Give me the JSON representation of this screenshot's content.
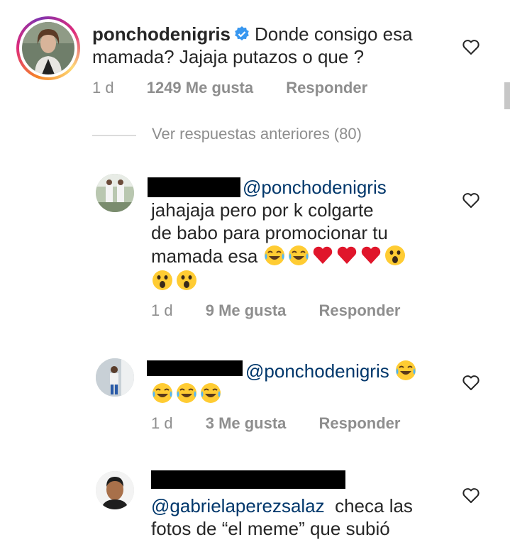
{
  "comments": [
    {
      "username": "ponchodenigris",
      "verified": true,
      "text": "Donde consigo esa mamada? Jajaja putazos o que ?",
      "time": "1 d",
      "likes": "1249 Me gusta",
      "reply": "Responder"
    },
    {
      "mention": "@ponchodenigris",
      "text_line1": "jahajaja pero por k colgarte",
      "text_line2": "de babo para promocionar tu",
      "text_line3": "mamada esa",
      "emoji_line3": [
        "joy-emoji",
        "joy-emoji",
        "heart-emoji",
        "heart-emoji",
        "heart-emoji",
        "astonished-emoji"
      ],
      "emoji_line4": [
        "astonished-emoji",
        "astonished-emoji"
      ],
      "time": "1 d",
      "likes": "9 Me gusta",
      "reply": "Responder"
    },
    {
      "mention": "@ponchodenigris",
      "emoji_line1": [
        "joy-emoji"
      ],
      "emoji_line2": [
        "joy-emoji",
        "joy-emoji",
        "joy-emoji"
      ],
      "time": "1 d",
      "likes": "3 Me gusta",
      "reply": "Responder"
    },
    {
      "mention": "@gabrielaperezsalaz",
      "text_line1": "checa las",
      "text_line2": "fotos de “el meme” que subió"
    }
  ],
  "view_previous": "Ver respuestas anteriores (80)",
  "colors": {
    "text": "#262626",
    "meta": "#8e8e8e",
    "mention": "#00376b",
    "verified": "#3897f0"
  }
}
